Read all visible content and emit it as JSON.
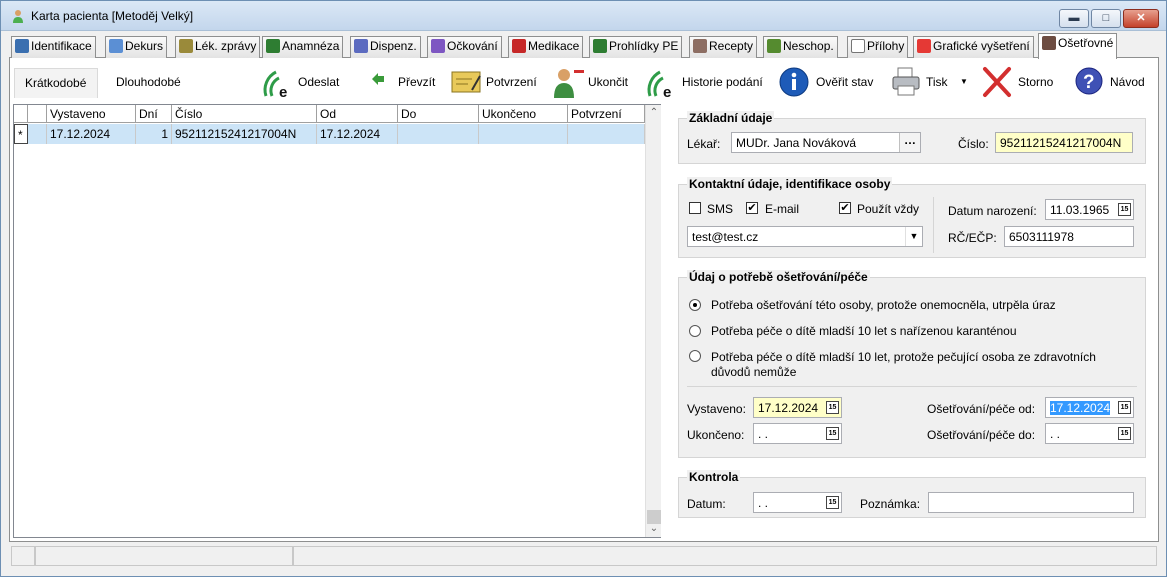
{
  "window": {
    "title": "Karta pacienta [Metoděj Velký]",
    "min_icon": "minimize-icon",
    "max_icon": "maximize-icon",
    "close_icon": "close-icon"
  },
  "tabs": [
    {
      "label": "Identifikace",
      "icon": "id-card-icon",
      "color": "#3a6fb0"
    },
    {
      "label": "Dekurs",
      "icon": "document-icon",
      "color": "#5b8fd4"
    },
    {
      "label": "Lék. zprávy",
      "icon": "report-icon",
      "color": "#9a8a3a"
    },
    {
      "label": "Anamnéza",
      "icon": "dna-icon",
      "color": "#2e7d32"
    },
    {
      "label": "Dispenz.",
      "icon": "people-icon",
      "color": "#5c6bc0"
    },
    {
      "label": "Očkování",
      "icon": "syringe-icon",
      "color": "#7e57c2"
    },
    {
      "label": "Medikace",
      "icon": "medication-icon",
      "color": "#c62828"
    },
    {
      "label": "Prohlídky PE",
      "icon": "stethoscope-icon",
      "color": "#2e7d32"
    },
    {
      "label": "Recepty",
      "icon": "prescription-icon",
      "color": "#8d6e63"
    },
    {
      "label": "Neschop.",
      "icon": "sick-person-icon",
      "color": "#558b2f"
    },
    {
      "label": "Přílohy",
      "icon": "paperclip-icon",
      "color": "#757575"
    },
    {
      "label": "Grafické vyšetření",
      "icon": "palette-icon",
      "color": "#e53935"
    },
    {
      "label": "Ošetřovné",
      "icon": "nursing-icon",
      "color": "#6d4c41"
    }
  ],
  "subtabs": [
    "Krátkodobé",
    "Dlouhodobé"
  ],
  "toolbar": {
    "odeslat": "Odeslat",
    "prevzit": "Převzít",
    "potvrzeni": "Potvrzení",
    "ukoncit": "Ukončit",
    "historie": "Historie podání",
    "overit": "Ověřit stav",
    "tisk": "Tisk",
    "storno": "Storno",
    "navod": "Návod"
  },
  "grid": {
    "columns": [
      "Vystaveno",
      "Dní",
      "Číslo",
      "Od",
      "Do",
      "Ukončeno",
      "Potvrzení"
    ],
    "rows": [
      {
        "marker": "*",
        "cells": [
          "17.12.2024",
          "1",
          "95211215241217004N",
          "17.12.2024",
          "",
          "",
          ""
        ]
      }
    ]
  },
  "zakladni": {
    "legend": "Základní údaje",
    "lekar_label": "Lékař:",
    "lekar_value": "MUDr. Jana Nováková",
    "cislo_label": "Číslo:",
    "cislo_value": "95211215241217004N"
  },
  "kontakt": {
    "legend": "Kontaktní údaje, identifikace osoby",
    "sms_label": "SMS",
    "email_label": "E-mail",
    "pouzit_label": "Použít vždy",
    "sms_checked": false,
    "email_checked": true,
    "pouzit_checked": true,
    "email_value": "test@test.cz",
    "datum_label": "Datum narození:",
    "datum_value": "11.03.1965",
    "rc_label": "RČ/EČP:",
    "rc_value": "6503111978"
  },
  "udaj": {
    "legend": "Údaj o potřebě ošetřování/péče",
    "options": [
      "Potřeba ošetřování této osoby, protože onemocněla, utrpěla úraz",
      "Potřeba péče o dítě mladší 10 let s nařízenou karanténou",
      "Potřeba péče o dítě mladší 10 let, protože pečující osoba ze zdravotních",
      "důvodů nemůže"
    ],
    "selected_option": 0,
    "vystaveno_label": "Vystaveno:",
    "vystaveno_value": "17.12.2024",
    "ukonceno_label": "Ukončeno:",
    "ukonceno_value": " .  .",
    "od_label": "Ošetřování/péče od:",
    "od_value": "17.12.2024",
    "do_label": "Ošetřování/péče do:",
    "do_value": " .  ."
  },
  "kontrola": {
    "legend": "Kontrola",
    "datum_label": "Datum:",
    "datum_value": " .  .",
    "poznamka_label": "Poznámka:",
    "poznamka_value": ""
  },
  "calendar_glyph": "15"
}
